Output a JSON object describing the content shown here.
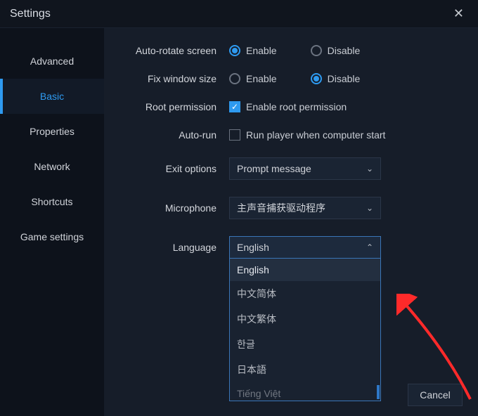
{
  "title": "Settings",
  "sidebar": {
    "items": [
      {
        "label": "Advanced"
      },
      {
        "label": "Basic"
      },
      {
        "label": "Properties"
      },
      {
        "label": "Network"
      },
      {
        "label": "Shortcuts"
      },
      {
        "label": "Game settings"
      }
    ],
    "activeIndex": 1
  },
  "rows": {
    "autoRotate": {
      "label": "Auto-rotate screen",
      "enable": "Enable",
      "disable": "Disable",
      "value": "enable"
    },
    "fixWindow": {
      "label": "Fix window size",
      "enable": "Enable",
      "disable": "Disable",
      "value": "disable"
    },
    "root": {
      "label": "Root permission",
      "checkbox": "Enable root permission",
      "checked": true
    },
    "autoRun": {
      "label": "Auto-run",
      "checkbox": "Run player when computer start",
      "checked": false
    },
    "exit": {
      "label": "Exit options",
      "value": "Prompt message"
    },
    "microphone": {
      "label": "Microphone",
      "value": "主声音捕获驱动程序"
    },
    "language": {
      "label": "Language",
      "value": "English",
      "options": [
        "English",
        "中文简体",
        "中文繁体",
        "한글",
        "日本語",
        "Tiếng Việt"
      ]
    }
  },
  "buttons": {
    "cancel": "Cancel"
  }
}
